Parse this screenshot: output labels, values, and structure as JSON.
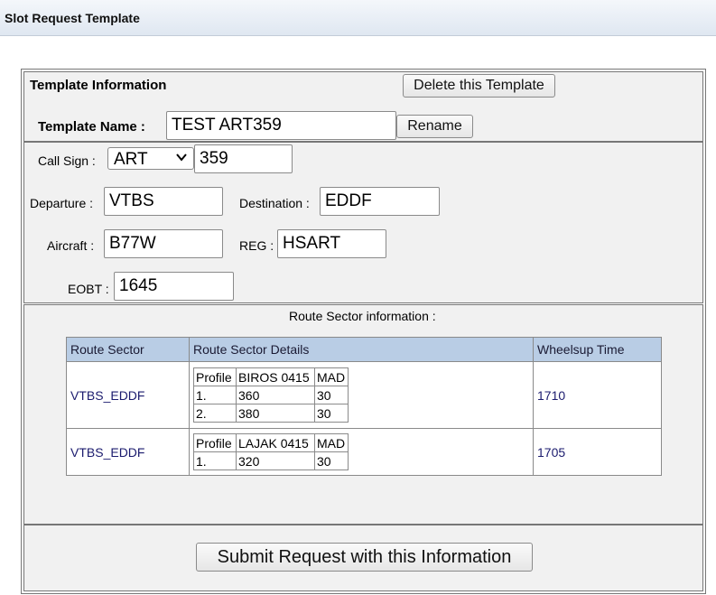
{
  "page": {
    "title": "Slot Request Template"
  },
  "template_info": {
    "heading": "Template Information",
    "delete_button": "Delete this Template",
    "name_label": "Template Name :",
    "name_value": "TEST ART359",
    "rename_button": "Rename"
  },
  "flight": {
    "callsign_label": "Call Sign :",
    "callsign_prefix": "ART",
    "callsign_number": "359",
    "departure_label": "Departure :",
    "departure_value": "VTBS",
    "destination_label": "Destination :",
    "destination_value": "EDDF",
    "aircraft_label": "Aircraft :",
    "aircraft_value": "B77W",
    "reg_label": "REG :",
    "reg_value": "HSART",
    "eobt_label": "EOBT :",
    "eobt_value": "1645"
  },
  "route": {
    "heading": "Route Sector information :",
    "columns": [
      "Route Sector",
      "Route Sector Details",
      "Wheelsup Time"
    ],
    "rows": [
      {
        "sector": "VTBS_EDDF",
        "details": {
          "header": [
            "Profile",
            "BIROS 0415",
            "MAD"
          ],
          "lines": [
            [
              "1.",
              "360",
              "30"
            ],
            [
              "2.",
              "380",
              "30"
            ]
          ]
        },
        "wheelsup": "1710"
      },
      {
        "sector": "VTBS_EDDF",
        "details": {
          "header": [
            "Profile",
            "LAJAK 0415",
            "MAD"
          ],
          "lines": [
            [
              "1.",
              "320",
              "30"
            ]
          ]
        },
        "wheelsup": "1705"
      }
    ]
  },
  "submit_button": "Submit Request with this Information"
}
